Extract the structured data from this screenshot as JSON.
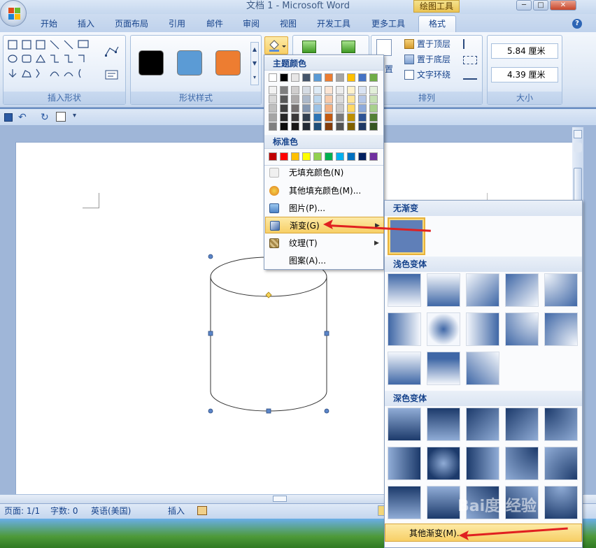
{
  "window": {
    "title": "文档 1 - Microsoft Word",
    "contextual_tab": "绘图工具",
    "controls": [
      "─",
      "□",
      "✕"
    ]
  },
  "ribbon_tabs": [
    "开始",
    "插入",
    "页面布局",
    "引用",
    "邮件",
    "审阅",
    "视图",
    "开发工具",
    "更多工具",
    "格式"
  ],
  "active_tab": "格式",
  "help_label": "?",
  "groups": {
    "insert_shapes": "插入形状",
    "shape_styles": "形状样式",
    "arrange": "排列",
    "size": "大小"
  },
  "style_swatches": [
    {
      "name": "black",
      "color": "#000000"
    },
    {
      "name": "blue",
      "color": "#5b9bd5"
    },
    {
      "name": "orange",
      "color": "#ed7d31"
    }
  ],
  "arrange": {
    "bring_front": "置于顶层",
    "send_back": "置于底层",
    "text_wrap": "文字环绕",
    "position_partial": "置"
  },
  "size": {
    "height": "5.84 厘米",
    "width": "4.39 厘米"
  },
  "color_menu": {
    "theme_header": "主题颜色",
    "standard_header": "标准色",
    "theme_top": [
      "#ffffff",
      "#000000",
      "#e7e6e6",
      "#44546a",
      "#5b9bd5",
      "#ed7d31",
      "#a5a5a5",
      "#ffc000",
      "#4472c4",
      "#70ad47"
    ],
    "theme_shades": [
      [
        "#f2f2f2",
        "#7f7f7f",
        "#d0cece",
        "#d6dce4",
        "#deebf6",
        "#fbe5d5",
        "#ededed",
        "#fff2cc",
        "#dae3f3",
        "#e2efd9"
      ],
      [
        "#d8d8d8",
        "#595959",
        "#aeabab",
        "#adb9ca",
        "#bdd7ee",
        "#f7cbac",
        "#dbdbdb",
        "#fee599",
        "#b4c6e7",
        "#c5e0b3"
      ],
      [
        "#bfbfbf",
        "#3f3f3f",
        "#757070",
        "#8496b0",
        "#9dc3e6",
        "#f4b183",
        "#c9c9c9",
        "#ffd966",
        "#8eaadb",
        "#a8d08d"
      ],
      [
        "#a5a5a5",
        "#262626",
        "#3a3838",
        "#323f4f",
        "#2e75b5",
        "#c55a11",
        "#7b7b7b",
        "#bf9000",
        "#2f5496",
        "#538135"
      ],
      [
        "#7f7f7f",
        "#0c0c0c",
        "#171616",
        "#222a35",
        "#1e4e79",
        "#833c0b",
        "#525252",
        "#7f6000",
        "#1f3864",
        "#375623"
      ]
    ],
    "standard": [
      "#c00000",
      "#ff0000",
      "#ffc000",
      "#ffff00",
      "#92d050",
      "#00b050",
      "#00b0f0",
      "#0070c0",
      "#002060",
      "#7030a0"
    ],
    "items": [
      {
        "label": "无填充颜色(N)",
        "icon": "no-fill-icon"
      },
      {
        "label": "其他填充颜色(M)...",
        "icon": "palette-icon"
      },
      {
        "label": "图片(P)...",
        "icon": "picture-icon"
      },
      {
        "label": "渐变(G)",
        "icon": "gradient-icon"
      },
      {
        "label": "纹理(T)",
        "icon": "texture-icon"
      },
      {
        "label": "图案(A)...",
        "icon": "pattern-icon"
      }
    ]
  },
  "gradient_menu": {
    "none_header": "无渐变",
    "light_header": "浅色变体",
    "dark_header": "深色变体",
    "more_label": "其他渐变(M)...",
    "light_count": 13,
    "dark_count": 15
  },
  "status": {
    "page": "页面: 1/1",
    "words": "字数: 0",
    "lang": "英语(美国)",
    "mode": "插入"
  },
  "watermark": "Bai度 经验"
}
